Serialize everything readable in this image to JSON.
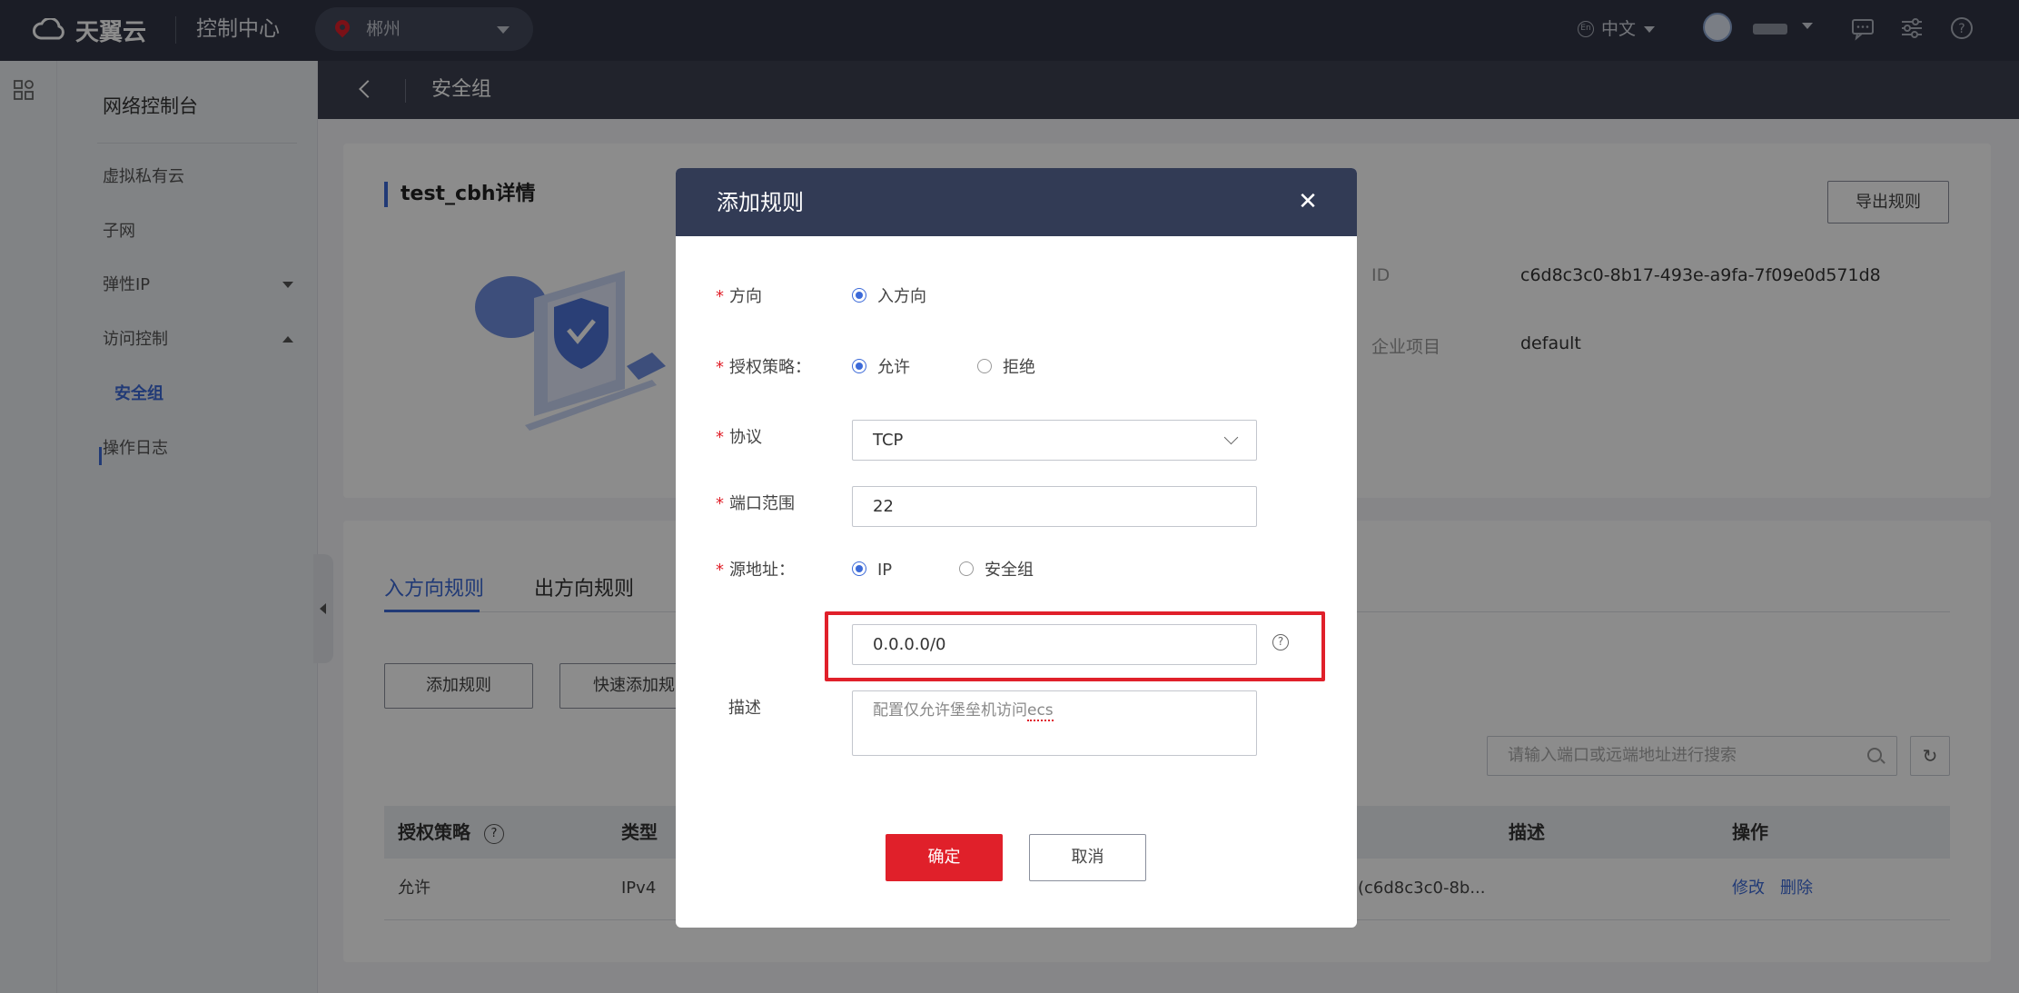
{
  "topbar": {
    "brand": "天翼云",
    "console": "控制中心",
    "region": "郴州",
    "language": "中文",
    "lang_badge": "En",
    "icons": [
      "message-icon",
      "settings-sliders-icon",
      "help-icon"
    ]
  },
  "sidebar": {
    "title": "网络控制台",
    "items": [
      {
        "label": "虚拟私有云"
      },
      {
        "label": "子网"
      },
      {
        "label": "弹性IP"
      },
      {
        "label": "访问控制"
      },
      {
        "label": "安全组"
      },
      {
        "label": "操作日志"
      }
    ]
  },
  "subheader": {
    "title": "安全组"
  },
  "detail": {
    "title": "test_cbh详情",
    "export_label": "导出规则",
    "id_label": "ID",
    "id_value": "c6d8c3c0-8b17-493e-a9fa-7f09e0d571d8",
    "project_label": "企业项目",
    "project_value": "default"
  },
  "rules": {
    "tabs": [
      "入方向规则",
      "出方向规则"
    ],
    "add_button": "添加规则",
    "quick_add_button": "快速添加规",
    "search_placeholder": "请输入端口或远端地址进行搜索",
    "columns": [
      "授权策略",
      "类型",
      "描述",
      "操作"
    ],
    "row": {
      "policy": "允许",
      "type": "IPv4",
      "remote": "(c6d8c3c0-8b...",
      "actions": [
        "修改",
        "删除"
      ]
    }
  },
  "modal": {
    "title": "添加规则",
    "direction_label": "方向",
    "direction_option": "入方向",
    "policy_label": "授权策略：",
    "policy_options": [
      "允许",
      "拒绝"
    ],
    "protocol_label": "协议",
    "protocol_value": "TCP",
    "port_label": "端口范围",
    "port_value": "22",
    "source_label": "源地址：",
    "source_options": [
      "IP",
      "安全组"
    ],
    "source_value": "0.0.0.0/0",
    "desc_label": "描述",
    "desc_value_prefix": "配置仅允许堡垒机访问",
    "desc_value_suffix": "ecs",
    "ok": "确定",
    "cancel": "取消"
  },
  "colors": {
    "accent": "#3c6ad8",
    "danger": "#e0202a",
    "topbar": "#323645",
    "modal_header": "#323b55"
  }
}
